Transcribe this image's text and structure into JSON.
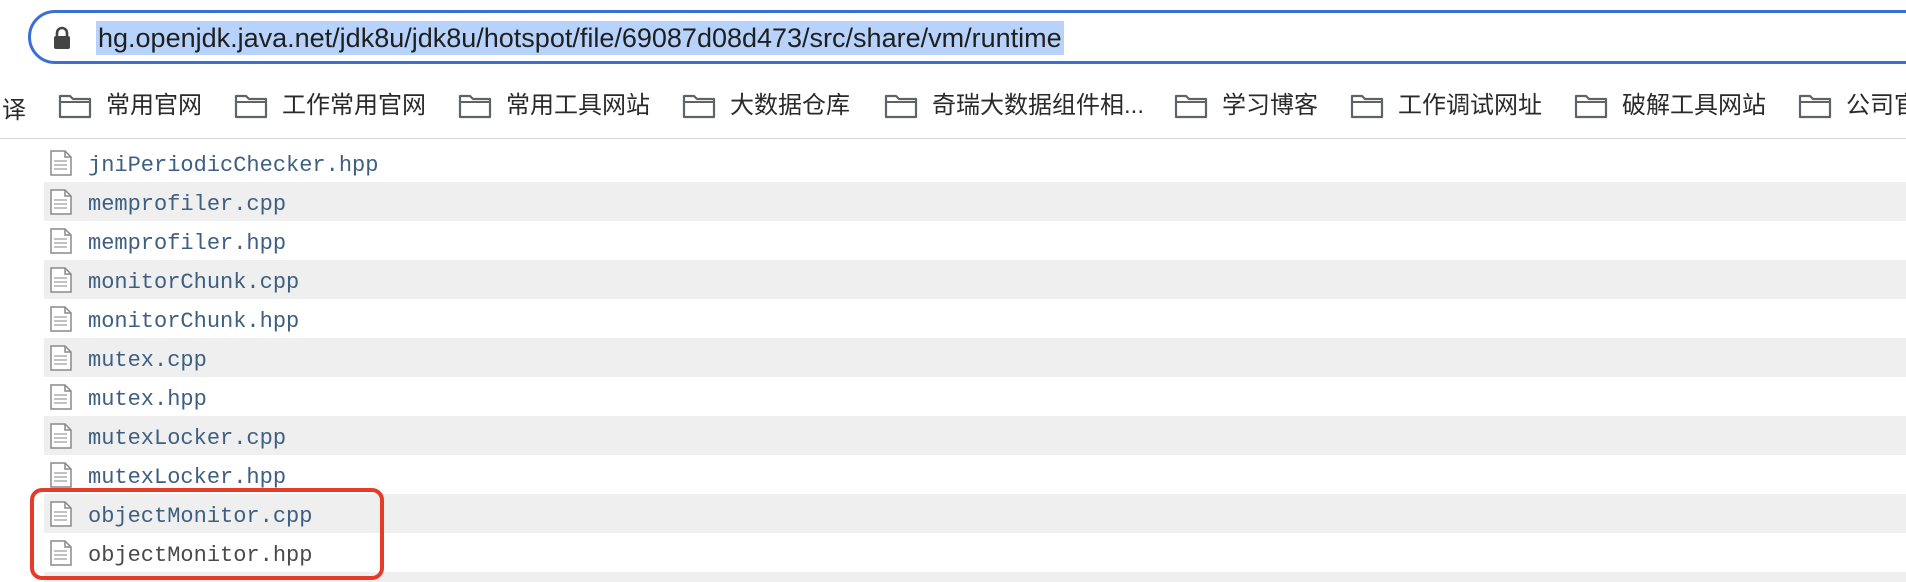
{
  "address_bar": {
    "url": "hg.openjdk.java.net/jdk8u/jdk8u/hotspot/file/69087d08d473/src/share/vm/runtime",
    "icon": "lock-icon"
  },
  "bookmarks": {
    "first_partial": "译",
    "items": [
      {
        "label": "常用官网",
        "icon": "folder-icon"
      },
      {
        "label": "工作常用官网",
        "icon": "folder-icon"
      },
      {
        "label": "常用工具网站",
        "icon": "folder-icon"
      },
      {
        "label": "大数据仓库",
        "icon": "folder-icon"
      },
      {
        "label": "奇瑞大数据组件相...",
        "icon": "folder-icon"
      },
      {
        "label": "学习博客",
        "icon": "folder-icon"
      },
      {
        "label": "工作调试网址",
        "icon": "folder-icon"
      },
      {
        "label": "破解工具网站",
        "icon": "folder-icon"
      },
      {
        "label": "公司官",
        "icon": "folder-icon"
      }
    ]
  },
  "files": [
    {
      "name": "jniPeriodicChecker.hpp",
      "icon": "file-icon"
    },
    {
      "name": "memprofiler.cpp",
      "icon": "file-icon"
    },
    {
      "name": "memprofiler.hpp",
      "icon": "file-icon"
    },
    {
      "name": "monitorChunk.cpp",
      "icon": "file-icon"
    },
    {
      "name": "monitorChunk.hpp",
      "icon": "file-icon"
    },
    {
      "name": "mutex.cpp",
      "icon": "file-icon"
    },
    {
      "name": "mutex.hpp",
      "icon": "file-icon"
    },
    {
      "name": "mutexLocker.cpp",
      "icon": "file-icon"
    },
    {
      "name": "mutexLocker.hpp",
      "icon": "file-icon"
    },
    {
      "name": "objectMonitor.cpp",
      "icon": "file-icon"
    },
    {
      "name": "objectMonitor.hpp",
      "icon": "file-icon"
    }
  ],
  "colors": {
    "omnibox_border": "#3b6fd4",
    "url_selection": "#b7d3fb",
    "file_link": "#3e5f82",
    "row_alt": "#efefef",
    "highlight_box": "#e53c2a"
  }
}
